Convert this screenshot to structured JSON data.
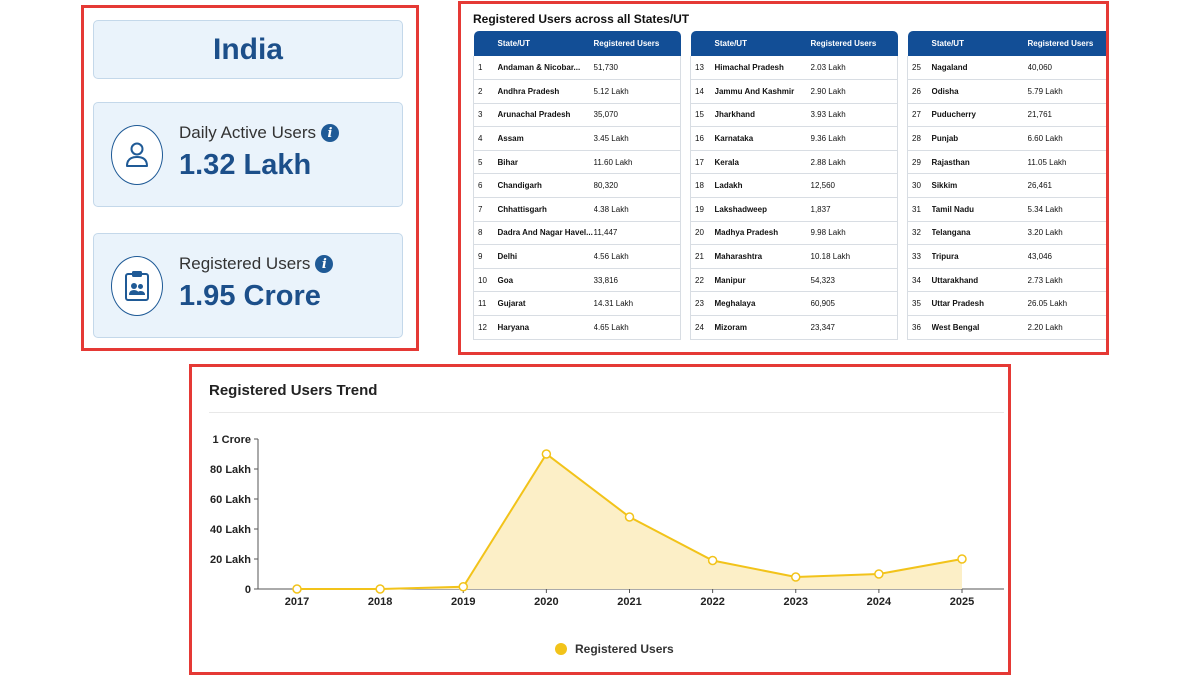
{
  "summary": {
    "country": "India",
    "daily_active": {
      "label": "Daily Active Users",
      "value": "1.32 Lakh"
    },
    "registered": {
      "label": "Registered Users",
      "value": "1.95 Crore"
    }
  },
  "states_table": {
    "title": "Registered Users across all States/UT",
    "headers": {
      "state": "State/UT",
      "users": "Registered Users"
    },
    "columns": [
      [
        {
          "n": "1",
          "state": "Andaman & Nicobar...",
          "users": "51,730"
        },
        {
          "n": "2",
          "state": "Andhra Pradesh",
          "users": "5.12 Lakh"
        },
        {
          "n": "3",
          "state": "Arunachal Pradesh",
          "users": "35,070"
        },
        {
          "n": "4",
          "state": "Assam",
          "users": "3.45 Lakh"
        },
        {
          "n": "5",
          "state": "Bihar",
          "users": "11.60 Lakh"
        },
        {
          "n": "6",
          "state": "Chandigarh",
          "users": "80,320"
        },
        {
          "n": "7",
          "state": "Chhattisgarh",
          "users": "4.38 Lakh"
        },
        {
          "n": "8",
          "state": "Dadra And Nagar Havel...",
          "users": "11,447"
        },
        {
          "n": "9",
          "state": "Delhi",
          "users": "4.56 Lakh"
        },
        {
          "n": "10",
          "state": "Goa",
          "users": "33,816"
        },
        {
          "n": "11",
          "state": "Gujarat",
          "users": "14.31 Lakh"
        },
        {
          "n": "12",
          "state": "Haryana",
          "users": "4.65 Lakh"
        }
      ],
      [
        {
          "n": "13",
          "state": "Himachal Pradesh",
          "users": "2.03 Lakh"
        },
        {
          "n": "14",
          "state": "Jammu And Kashmir",
          "users": "2.90 Lakh"
        },
        {
          "n": "15",
          "state": "Jharkhand",
          "users": "3.93 Lakh"
        },
        {
          "n": "16",
          "state": "Karnataka",
          "users": "9.36 Lakh"
        },
        {
          "n": "17",
          "state": "Kerala",
          "users": "2.88 Lakh"
        },
        {
          "n": "18",
          "state": "Ladakh",
          "users": "12,560"
        },
        {
          "n": "19",
          "state": "Lakshadweep",
          "users": "1,837"
        },
        {
          "n": "20",
          "state": "Madhya Pradesh",
          "users": "9.98 Lakh"
        },
        {
          "n": "21",
          "state": "Maharashtra",
          "users": "10.18 Lakh"
        },
        {
          "n": "22",
          "state": "Manipur",
          "users": "54,323"
        },
        {
          "n": "23",
          "state": "Meghalaya",
          "users": "60,905"
        },
        {
          "n": "24",
          "state": "Mizoram",
          "users": "23,347"
        }
      ],
      [
        {
          "n": "25",
          "state": "Nagaland",
          "users": "40,060"
        },
        {
          "n": "26",
          "state": "Odisha",
          "users": "5.79 Lakh"
        },
        {
          "n": "27",
          "state": "Puducherry",
          "users": "21,761"
        },
        {
          "n": "28",
          "state": "Punjab",
          "users": "6.60 Lakh"
        },
        {
          "n": "29",
          "state": "Rajasthan",
          "users": "11.05 Lakh"
        },
        {
          "n": "30",
          "state": "Sikkim",
          "users": "26,461"
        },
        {
          "n": "31",
          "state": "Tamil Nadu",
          "users": "5.34 Lakh"
        },
        {
          "n": "32",
          "state": "Telangana",
          "users": "3.20 Lakh"
        },
        {
          "n": "33",
          "state": "Tripura",
          "users": "43,046"
        },
        {
          "n": "34",
          "state": "Uttarakhand",
          "users": "2.73 Lakh"
        },
        {
          "n": "35",
          "state": "Uttar Pradesh",
          "users": "26.05 Lakh"
        },
        {
          "n": "36",
          "state": "West Bengal",
          "users": "2.20 Lakh"
        }
      ]
    ]
  },
  "chart_data": {
    "type": "area",
    "title": "Registered Users Trend",
    "x": [
      "2017",
      "2018",
      "2019",
      "2020",
      "2021",
      "2022",
      "2023",
      "2024",
      "2025"
    ],
    "series": [
      {
        "name": "Registered Users",
        "values": [
          0,
          0,
          1.5,
          90,
          48,
          19,
          8,
          10,
          20
        ]
      }
    ],
    "yunit": "Lakh",
    "ylim": [
      0,
      100
    ],
    "yticks": [
      {
        "value": 0,
        "label": "0"
      },
      {
        "value": 20,
        "label": "20 Lakh"
      },
      {
        "value": 40,
        "label": "40 Lakh"
      },
      {
        "value": 60,
        "label": "60 Lakh"
      },
      {
        "value": 80,
        "label": "80 Lakh"
      },
      {
        "value": 100,
        "label": "1 Crore"
      }
    ],
    "grid": false,
    "legend": "bottom-center",
    "colors": {
      "line": "#f2c31a",
      "fill": "#fcefc7"
    }
  }
}
